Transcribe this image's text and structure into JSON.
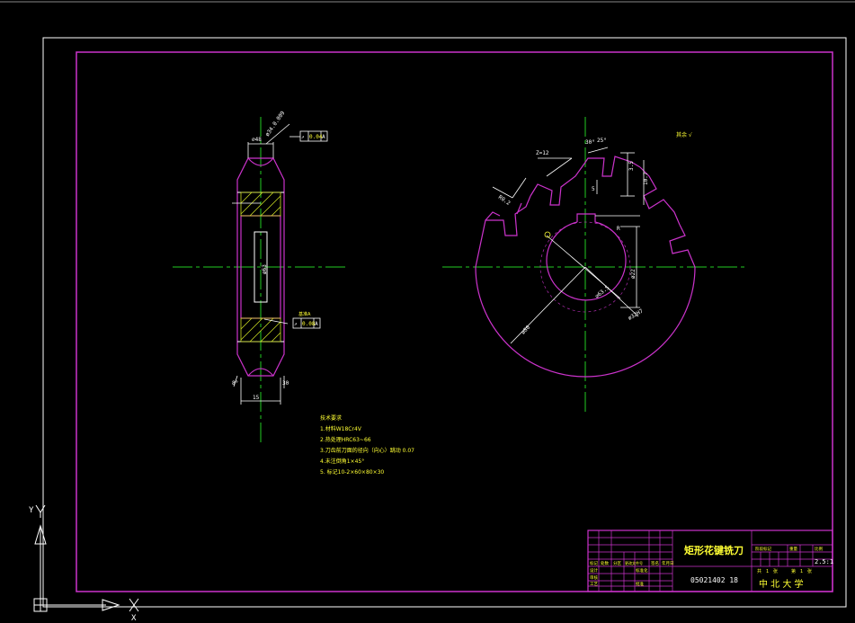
{
  "colors": {
    "background": "#000000",
    "border": "#ffffff",
    "frame": "#cc33cc",
    "outline": "#ffffff",
    "centerline": "#22cc22",
    "hatch": "#ccdd22",
    "dimension": "#ffffff",
    "note": "#ffff33",
    "titletext": "#ffff33"
  },
  "ucs": {
    "x_axis": "X",
    "y_axis": "Y"
  },
  "section_view": {
    "dim_top": "∅48",
    "dim_chamfer": "ø34.0.009",
    "dim_bottom": "15",
    "dim_right": "30",
    "dim_left": "8°",
    "dim_vertical": "ø63",
    "tolerance_top": {
      "symbol": "↗",
      "value": "0.04",
      "datum": "A"
    },
    "tolerance_bottom": {
      "symbol": "↗",
      "value": "0.08",
      "datum": "A"
    },
    "datum_label": "基准A"
  },
  "front_view": {
    "teeth_label": "Z=12",
    "angle_label": "30°",
    "angle_label2": "25°",
    "radial_dim": "R0.2",
    "key_dim": "10.7",
    "key_dim2": "3.5",
    "bore_dim": "ø22",
    "bore_dim2": "ø32H7",
    "outer_dim": "ø80",
    "pitch_dim": "∅63.5",
    "small_dim": "5",
    "pointer_dim": "R",
    "surface_mark": "其余 √"
  },
  "notes": {
    "title": "技术要求",
    "lines": [
      "1.材料W18Cr4V",
      "2.热处理HRC63~66",
      "3.刀齿前刀面的径向（向心）跳动 0.07",
      "4.未注倒角1×45°",
      "5. 标记10-2×60×80×30"
    ]
  },
  "title_block": {
    "drawing_name": "矩形花键铣刀",
    "drawing_number": "05021402 18",
    "school": "中 北 大 学",
    "scale": "2.5:1",
    "sheet": "1",
    "sheet_total": "1",
    "left_headers": [
      "标记",
      "处数",
      "分区",
      "更改文件号",
      "签名",
      "年月日"
    ],
    "left_rows": [
      [
        "设计",
        "",
        "",
        "标准化",
        "",
        ""
      ],
      [
        "审核",
        "",
        "",
        "",
        "",
        ""
      ],
      [
        "工艺",
        "",
        "",
        "批准",
        "",
        ""
      ]
    ],
    "right_headers": [
      "阶段标记",
      "重量",
      "比例"
    ],
    "sheet_labels": [
      "共",
      "张",
      "第",
      "张"
    ]
  }
}
